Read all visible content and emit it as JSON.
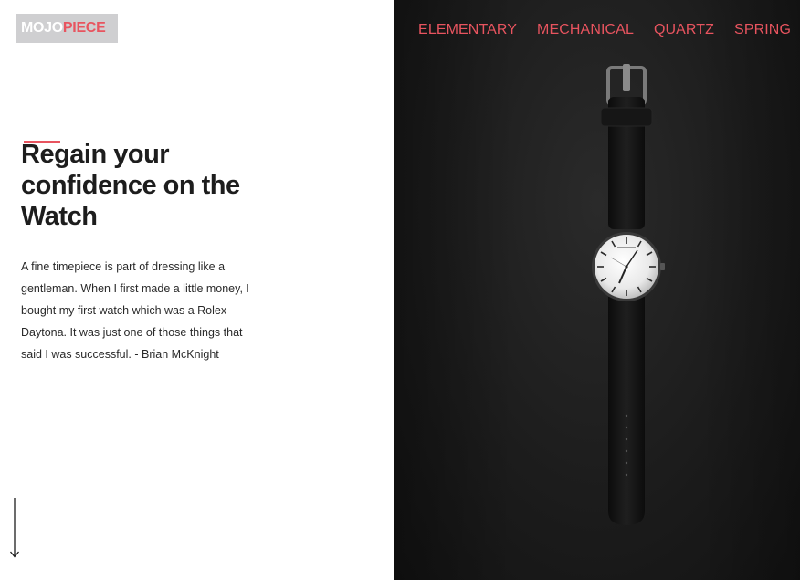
{
  "logo": {
    "part1": "MOJO",
    "part2": "PIECE"
  },
  "nav": {
    "items": [
      {
        "label": "ELEMENTARY"
      },
      {
        "label": "MECHANICAL"
      },
      {
        "label": "QUARTZ"
      },
      {
        "label": "SPRING"
      }
    ]
  },
  "hero": {
    "headline": "Regain your confidence on the Watch",
    "quote": "A fine timepiece is part of dressing like a gentleman. When I first made a little money, I bought my first watch which was a Rolex Daytona. It was just one of those things that said I was successful. - Brian McKnight"
  },
  "icons": {
    "scroll": "arrow-down-icon",
    "image": "wristwatch-icon"
  },
  "colors": {
    "accent": "#e8545f",
    "logo_bg": "#cfcfd1",
    "text": "#1d1d1d",
    "dark_bg": "#1c1c1c"
  }
}
